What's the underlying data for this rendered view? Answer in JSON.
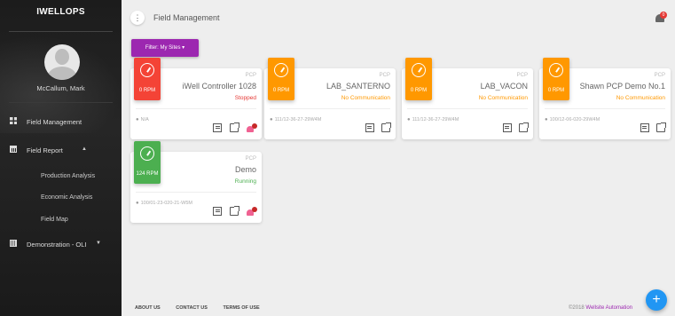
{
  "app": {
    "brand": "IWELLOPS"
  },
  "user": {
    "name": "McCallum, Mark"
  },
  "sidebar": {
    "items": [
      {
        "label": "Field Management"
      },
      {
        "label": "Field Report",
        "caret": "▲"
      },
      {
        "label": "Demonstration - OLI",
        "caret": "▼"
      }
    ],
    "sub_items": [
      {
        "label": "Production Analysis"
      },
      {
        "label": "Economic Analysis"
      },
      {
        "label": "Field Map"
      }
    ]
  },
  "header": {
    "title": "Field Management",
    "menu_icon": "⋮",
    "notification_count": "0"
  },
  "filter": {
    "label": "Filter: My Sites ▾"
  },
  "cards": [
    {
      "type": "PCP",
      "name": "iWell Controller 1028",
      "status": "Stopped",
      "rpm": "0 RPM",
      "location": "N/A",
      "color": "#f44336"
    },
    {
      "type": "PCP",
      "name": "LAB_SANTERNO",
      "status": "No Communication",
      "rpm": "0 RPM",
      "location": "111/12-36-27-29W4M",
      "color": "#ff9800"
    },
    {
      "type": "PCP",
      "name": "LAB_VACON",
      "status": "No Communication",
      "rpm": "0 RPM",
      "location": "111/12-36-27-29W4M",
      "color": "#ff9800"
    },
    {
      "type": "PCP",
      "name": "Shawn PCP Demo No.1",
      "status": "No Communication",
      "rpm": "0 RPM",
      "location": "100/12-06-020-29W4M",
      "color": "#ff9800"
    },
    {
      "type": "PCP",
      "name": "Demo",
      "status": "Running",
      "rpm": "124 RPM",
      "location": "100/01-23-020-21-W5M",
      "color": "#4caf50"
    }
  ],
  "footer": {
    "links": [
      "ABOUT US",
      "CONTACT US",
      "TERMS OF USE"
    ],
    "copyright": "©2018 ",
    "copyright_brand": "Wellsite Automation"
  },
  "fab": {
    "label": "+"
  }
}
